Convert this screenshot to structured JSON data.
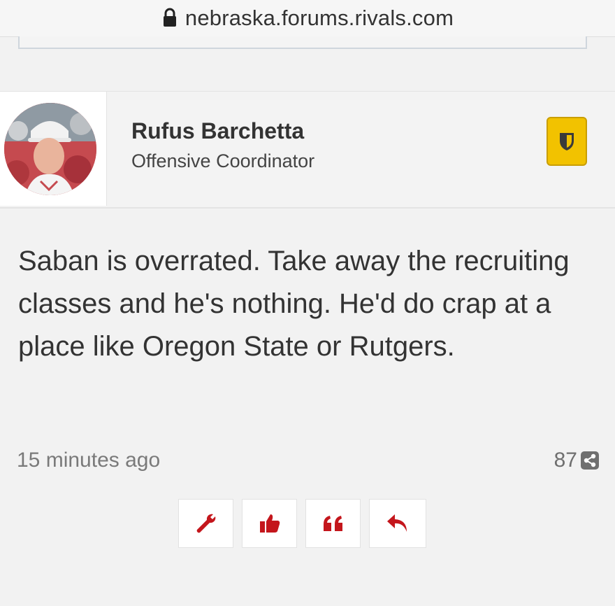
{
  "browser": {
    "url": "nebraska.forums.rivals.com",
    "lock_icon": "lock-icon"
  },
  "post": {
    "author": {
      "name": "Rufus Barchetta",
      "title": "Offensive Coordinator",
      "badge_icon": "shield-badge-icon",
      "badge_color": "#f2c200"
    },
    "message": "Saban is overrated. Take away the recruiting classes and he's nothing. He'd do crap at a place like Oregon State or Rutgers.",
    "timestamp": "15 minutes ago",
    "share_count": "87",
    "actions": [
      {
        "icon": "wrench-icon"
      },
      {
        "icon": "thumbs-up-icon"
      },
      {
        "icon": "quote-icon"
      },
      {
        "icon": "reply-icon"
      }
    ],
    "accent_color": "#c4161c"
  }
}
